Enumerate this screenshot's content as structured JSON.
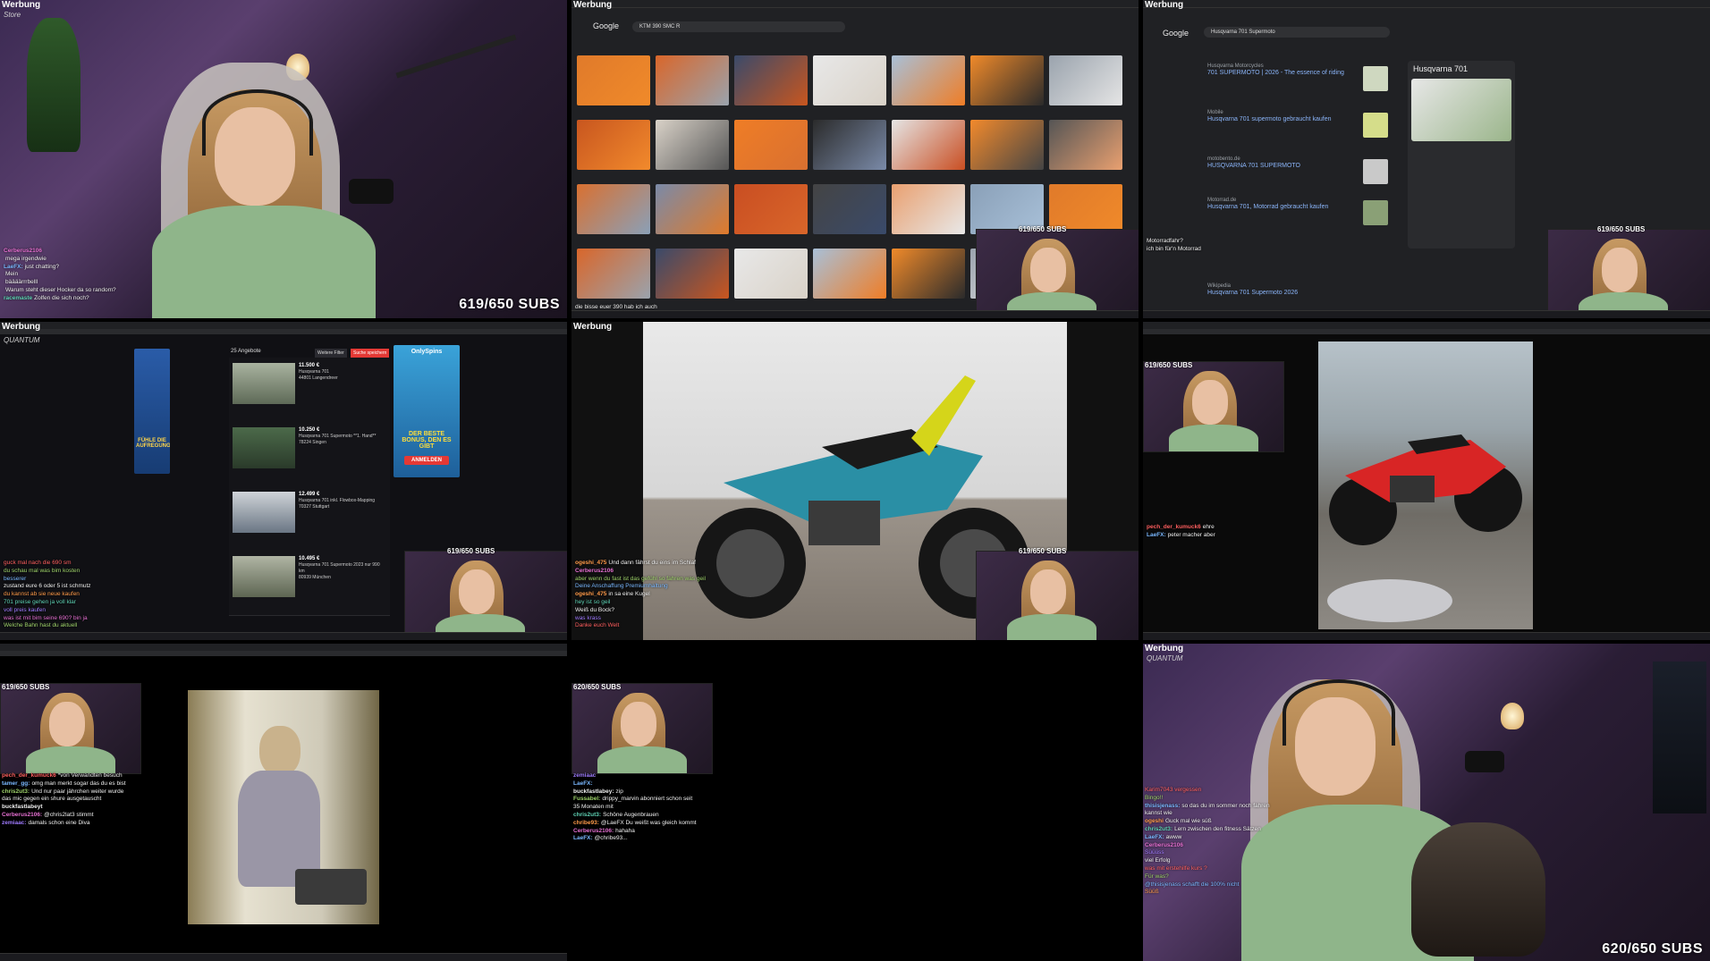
{
  "common": {
    "ad_label": "Werbung",
    "sponsor": "Store",
    "sponsor2": "QUANTUM",
    "subs_619": "619/650 SUBS",
    "subs_620": "620/650 SUBS"
  },
  "p1_chat": [
    {
      "u": "Cerberus2106",
      "m": "",
      "c": "#e56fd1"
    },
    {
      "u": "",
      "m": "mega irgendwie",
      "c": "#9fd36b"
    },
    {
      "u": "LaeFX:",
      "m": "just chatting?",
      "c": "#7ab8ff"
    },
    {
      "u": "",
      "m": "Mein",
      "c": "#ff9b4a"
    },
    {
      "u": "",
      "m": "bäääärrrbelll",
      "c": "#a07bff"
    },
    {
      "u": "",
      "m": "Warum steht dieser Hocker da so random?",
      "c": "#ff6060"
    },
    {
      "u": "racemaste",
      "m": "Zolfen die sich noch?",
      "c": "#5fd3b5"
    }
  ],
  "p2": {
    "google": "Google",
    "query": "KTM 390 SMC R",
    "chat_tail": "die bisse euer 390 hab ich auch"
  },
  "p3": {
    "google": "Google",
    "query": "Husqvarna 701 Supermoto",
    "panel_title": "Husqvarna 701",
    "results": [
      {
        "site": "Husqvarna Motorcycles",
        "title": "701 SUPERMOTO | 2026 - The essence of riding"
      },
      {
        "site": "Mobile",
        "title": "Husqvarna 701 supermoto gebraucht kaufen"
      },
      {
        "site": "motobento.de",
        "title": "HUSQVARNA 701 SUPERMOTO"
      },
      {
        "site": "Motorrad.de",
        "title": "Husqvarna 701, Motorrad gebraucht kaufen"
      },
      {
        "site": "Wikipedia",
        "title": "Husqvarna 701 Supermoto 2026"
      }
    ],
    "chat": [
      {
        "u": "",
        "m": "Motorradfahr?",
        "c": "#7ab8ff"
      },
      {
        "u": "",
        "m": "ich bin für'n Motorrad",
        "c": "#9fd36b"
      }
    ]
  },
  "p4": {
    "header": "25 Angebote",
    "buttons": [
      "Weitere Filter",
      "Suche speichern"
    ],
    "listings": [
      {
        "price": "11.500 €",
        "desc": "Husqvarna 701",
        "loc": "44801 Langendreer"
      },
      {
        "price": "10.250 €",
        "desc": "Husqvarna 701 Supermoto **1. Hand**",
        "loc": "78224 Singen"
      },
      {
        "price": "12.499 €",
        "desc": "Husqvarna 701 inkl. Flowbox-Mapping",
        "loc": "70327 Stuttgart"
      },
      {
        "price": "10.495 €",
        "desc": "Husqvarna 701 Supermoto 2023 nur 990 km",
        "loc": "80939 München"
      }
    ],
    "ad_left": "FÜHLE DIE AUFREGUNG",
    "ad_right_title": "OnlySpins",
    "ad_right_text": "DER BESTE BONUS, DEN ES GIBT",
    "ad_right_btn": "ANMELDEN",
    "chat": [
      {
        "u": "",
        "m": "guck mal nach die 690 sm",
        "c": "#ff6060"
      },
      {
        "u": "",
        "m": "du schau mal was bim kosten",
        "c": "#9fd36b"
      },
      {
        "u": "",
        "m": "besserer",
        "c": "#7ab8ff"
      },
      {
        "u": "",
        "m": "zustand eure 6 oder 5 ist schmutz",
        "c": "#eee"
      },
      {
        "u": "",
        "m": "du kannst ab sie neue kaufen",
        "c": "#ff9b4a"
      },
      {
        "u": "",
        "m": "701 preise gehen ja voll klar",
        "c": "#5fd3b5"
      },
      {
        "u": "",
        "m": "voll preis kaufen",
        "c": "#a07bff"
      },
      {
        "u": "",
        "m": "was ist mit bim seine 690? bin ja",
        "c": "#e56fd1"
      },
      {
        "u": "",
        "m": "Welche Bahn hast du aktuell",
        "c": "#9fd36b"
      }
    ]
  },
  "p5": {
    "chat": [
      {
        "u": "ogeshi_475",
        "m": "Und dann fährst du eins im Schlaf",
        "c": "#ff9b4a"
      },
      {
        "u": "Cerberus2106",
        "m": "",
        "c": "#e56fd1"
      },
      {
        "u": "",
        "m": "aber wenn du fast ist das gefühl so fahren was geil",
        "c": "#9fd36b"
      },
      {
        "u": "",
        "m": "Deine Anschaffung Premiumhaltung",
        "c": "#7ab8ff"
      },
      {
        "u": "ogeshi_475",
        "m": "in sa eine Kugel",
        "c": "#ff9b4a"
      },
      {
        "u": "",
        "m": "hey ist so geil",
        "c": "#5fd3b5"
      },
      {
        "u": "",
        "m": "Weiß du Bock?",
        "c": "#eee"
      },
      {
        "u": "",
        "m": "was krass",
        "c": "#a07bff"
      },
      {
        "u": "",
        "m": "Danke euch Welt",
        "c": "#ff6060"
      }
    ]
  },
  "p6": {
    "chat": [
      {
        "u": "pech_der_kumuck6",
        "m": "ehre",
        "c": "#ff6060"
      },
      {
        "u": "LaeFX:",
        "m": "peter macher aber",
        "c": "#7ab8ff"
      }
    ]
  },
  "p7": {
    "chat": [
      {
        "u": "pech_der_kumuck6",
        "m": "*von Verwandten besuch",
        "c": "#ff6060"
      },
      {
        "u": "tamer_gg:",
        "m": "omg man merkt sogar das du es bist",
        "c": "#7ab8ff"
      },
      {
        "u": "chris2ut3:",
        "m": "Und nur paar jährchen weiter wurde das mic gegen ein shure ausgetauscht",
        "c": "#9fd36b"
      },
      {
        "u": "buckfastlabeyt",
        "m": "",
        "c": "#eee"
      },
      {
        "u": "Cerberus2106:",
        "m": "@chris2lat3 stimmt",
        "c": "#e56fd1"
      },
      {
        "u": "zemiaac:",
        "m": "damals schon eine Diva",
        "c": "#a07bff"
      }
    ]
  },
  "p8": {
    "chat": [
      {
        "u": "zemiaac",
        "m": "",
        "c": "#a07bff"
      },
      {
        "u": "LaeFX:",
        "m": "",
        "c": "#7ab8ff"
      },
      {
        "u": "buckfastlabey:",
        "m": "zip",
        "c": "#eee"
      },
      {
        "u": "Fussabel:",
        "m": "drippy_marvin abonniert schon seit 35 Monaten mit",
        "c": "#9fd36b"
      },
      {
        "u": "chris2ut3:",
        "m": "Schöne Augenbrauen",
        "c": "#5fd3b5"
      },
      {
        "u": "chribe93:",
        "m": "@LaeFX Du weißt was gleich kommt",
        "c": "#ff9b4a"
      },
      {
        "u": "Cerberus2106:",
        "m": "hahaha",
        "c": "#e56fd1"
      },
      {
        "u": "LaeFX:",
        "m": "@chribe93...",
        "c": "#7ab8ff"
      }
    ]
  },
  "p9": {
    "chat": [
      {
        "u": "",
        "m": "Karim7043 vergessen",
        "c": "#ff6060"
      },
      {
        "u": "",
        "m": "Bingo!!",
        "c": "#9fd36b"
      },
      {
        "u": "thisisjenass:",
        "m": "so das du im sommer noch fahren kannst wie",
        "c": "#7ab8ff"
      },
      {
        "u": "ogeshi",
        "m": "Guck mal wie süß",
        "c": "#ff9b4a"
      },
      {
        "u": "chris2ut3:",
        "m": "Lern zwischen den fitness Sätzen",
        "c": "#5fd3b5"
      },
      {
        "u": "LaeFX:",
        "m": "awww",
        "c": "#7ab8ff"
      },
      {
        "u": "Cerberus2106",
        "m": "",
        "c": "#e56fd1"
      },
      {
        "u": "",
        "m": "Süüüss",
        "c": "#a07bff"
      },
      {
        "u": "",
        "m": "viel Erfolg",
        "c": "#eee"
      },
      {
        "u": "",
        "m": "was mit erstehilfe kurs ?",
        "c": "#ff6060"
      },
      {
        "u": "",
        "m": "Für was?",
        "c": "#9fd36b"
      },
      {
        "u": "",
        "m": "@thisisjenass schafft die 100% nicht",
        "c": "#7ab8ff"
      },
      {
        "u": "",
        "m": "Süüß",
        "c": "#ff9b4a"
      }
    ]
  }
}
